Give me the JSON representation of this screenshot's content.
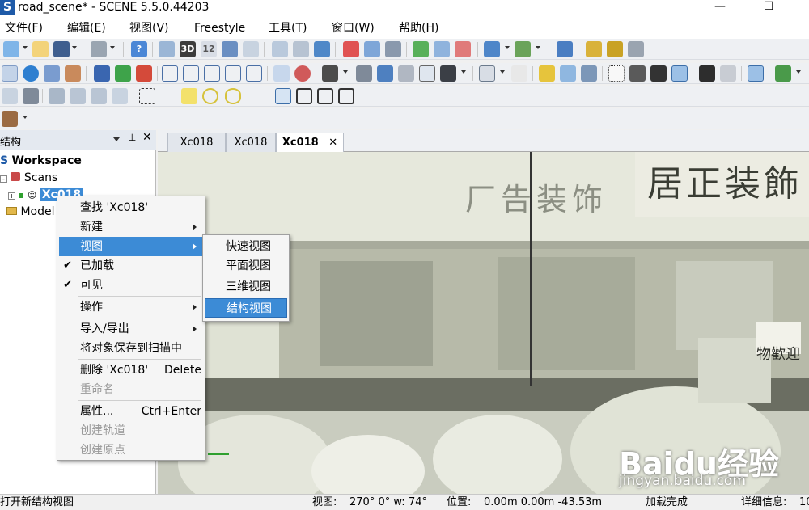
{
  "window": {
    "title": "road_scene* - SCENE 5.5.0.44203",
    "logo_letter": "S",
    "minimize_glyph": "—",
    "maximize_glyph": "☐"
  },
  "menu": [
    {
      "label": "文件(F)"
    },
    {
      "label": "编辑(E)"
    },
    {
      "label": "视图(V)"
    },
    {
      "label": "Freestyle"
    },
    {
      "label": "工具(T)"
    },
    {
      "label": "窗口(W)"
    },
    {
      "label": "帮助(H)"
    }
  ],
  "toolbar": {
    "btn_3d": "3D",
    "btn_12": "12"
  },
  "structure_panel": {
    "title": "结构",
    "workspace_label": "Workspace",
    "scans_label": "Scans",
    "scan_item_label": "Xc018",
    "models_label": "Model"
  },
  "tabs": [
    {
      "label": "Xc018"
    },
    {
      "label": "Xc018"
    },
    {
      "label": "Xc018"
    }
  ],
  "context_menu": {
    "items": [
      {
        "label": "查找 'Xc018'"
      },
      {
        "label": "新建"
      },
      {
        "label": "视图"
      },
      {
        "label": "已加载"
      },
      {
        "label": "可见"
      },
      {
        "label": "操作"
      },
      {
        "label": "导入/导出"
      },
      {
        "label": "将对象保存到扫描中"
      },
      {
        "label": "删除 'Xc018'",
        "shortcut": "Delete"
      },
      {
        "label": "重命名"
      },
      {
        "label": "属性...",
        "shortcut": "Ctrl+Enter"
      },
      {
        "label": "创建轨道"
      },
      {
        "label": "创建原点"
      }
    ]
  },
  "view_submenu": {
    "items": [
      {
        "label": "快速视图"
      },
      {
        "label": "平面视图"
      },
      {
        "label": "三维视图"
      },
      {
        "label": "结构视图"
      }
    ]
  },
  "scene_signs": {
    "sign_right": "居正装飾",
    "sign_left": "厂告装饰",
    "small_sign": "物歡迎"
  },
  "watermark": {
    "brand": "Baidu经验",
    "url": "jingyan.baidu.com"
  },
  "statusbar": {
    "message": "打开新结构视图",
    "view_label": "视图:",
    "view_value": "270° 0° w:",
    "fov_value": "74°",
    "pos_label": "位置:",
    "pos_value": "0.00m 0.00m -43.53m",
    "load_status": "加载完成",
    "detail_label": "详细信息:",
    "detail_value": "10"
  },
  "colors": {
    "accent": "#3c8bd6",
    "scene_bg": "#dfe2d5",
    "toolbar_bg": "#eef0f3"
  }
}
